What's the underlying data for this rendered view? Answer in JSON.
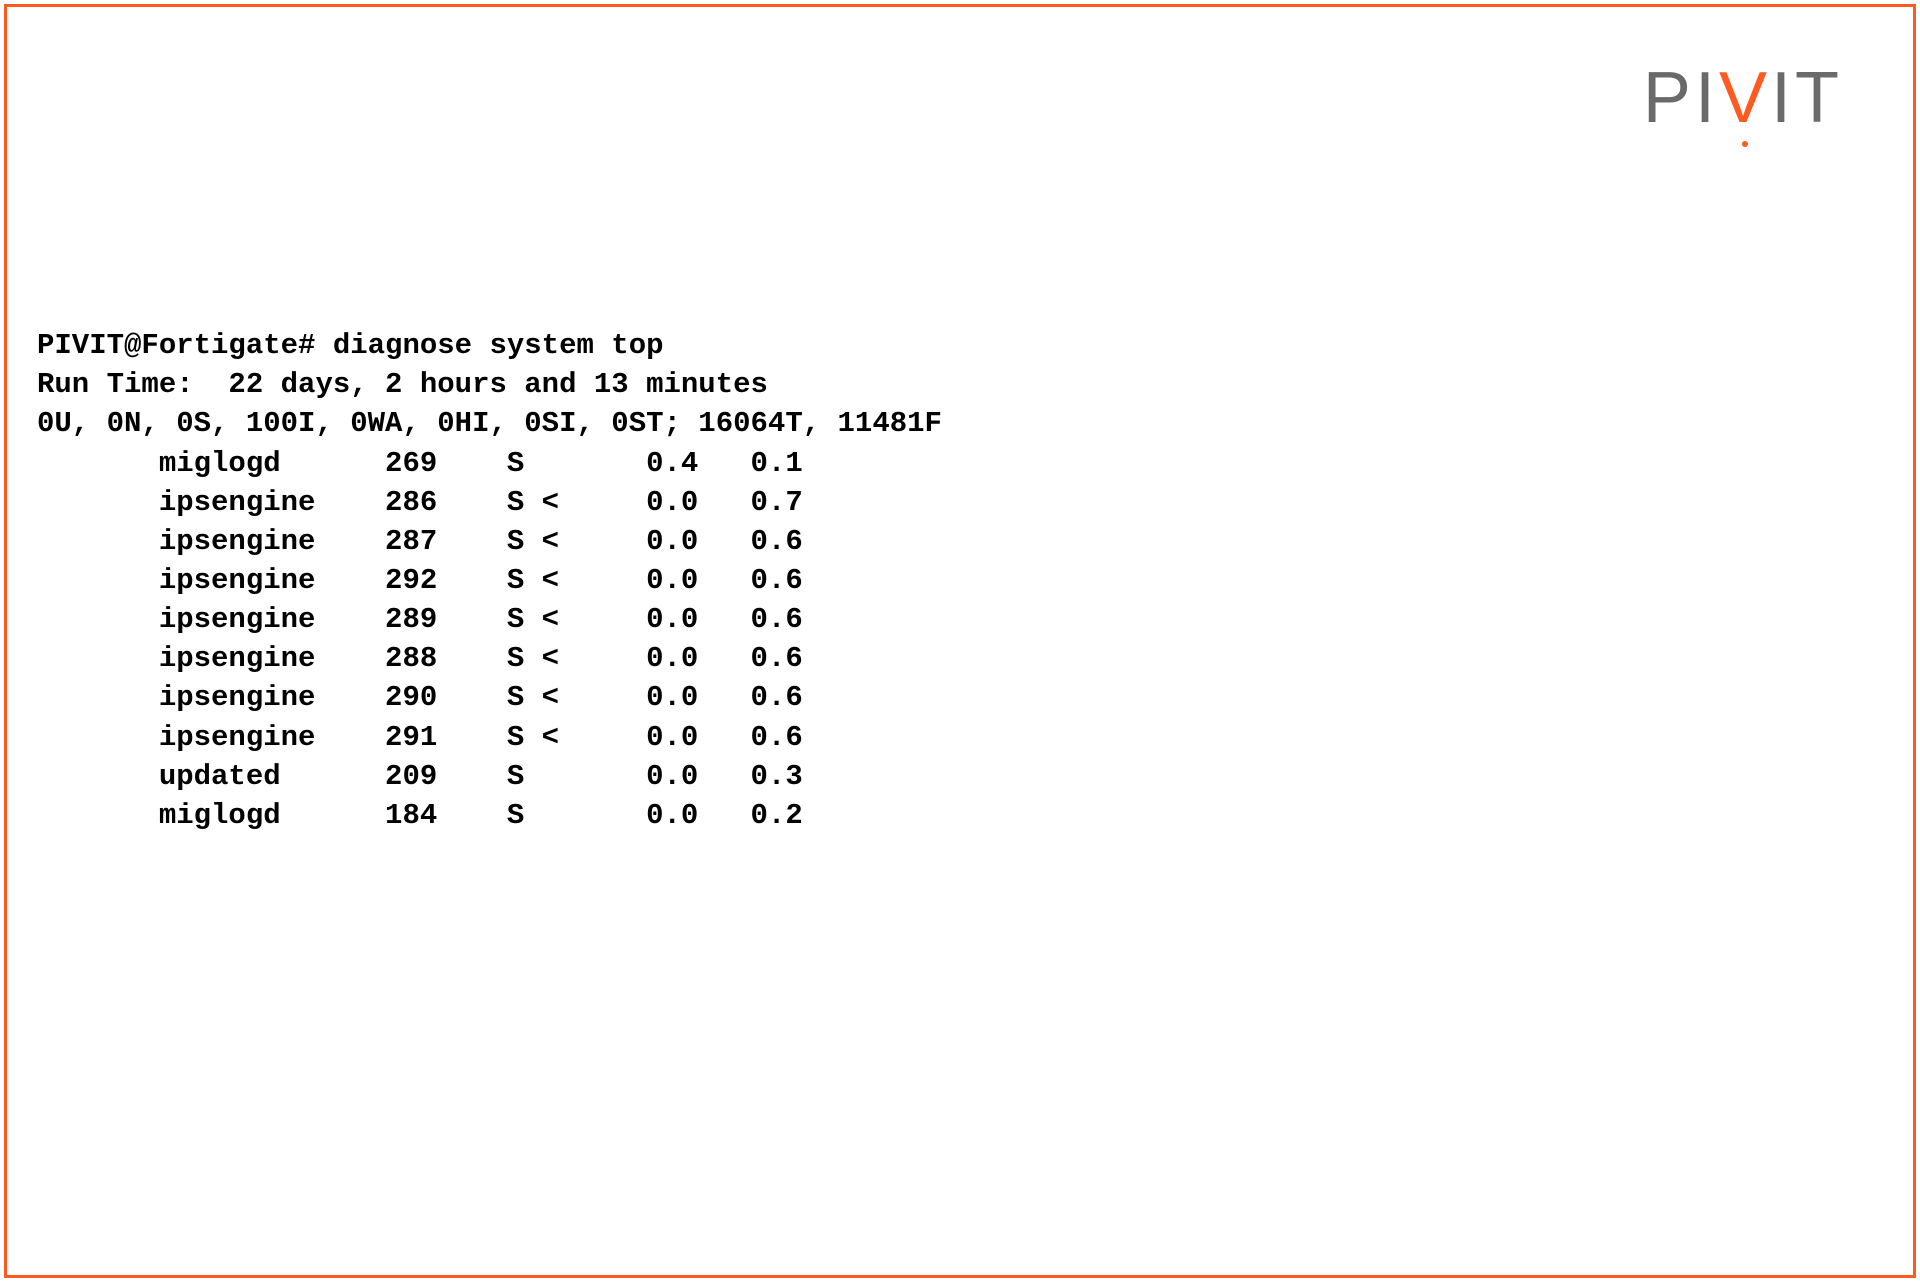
{
  "logo": {
    "p": "P",
    "i1": "I",
    "v": "V",
    "i2": "I",
    "t": "T"
  },
  "terminal": {
    "prompt_line": "PIVIT@Fortigate# diagnose system top",
    "runtime_line": "Run Time:  22 days, 2 hours and 13 minutes",
    "stats_line": "0U, 0N, 0S, 100I, 0WA, 0HI, 0SI, 0ST; 16064T, 11481F",
    "processes": [
      {
        "name": "miglogd",
        "pid": "269",
        "state": "S",
        "cpu": "0.4",
        "mem": "0.1"
      },
      {
        "name": "ipsengine",
        "pid": "286",
        "state": "S <",
        "cpu": "0.0",
        "mem": "0.7"
      },
      {
        "name": "ipsengine",
        "pid": "287",
        "state": "S <",
        "cpu": "0.0",
        "mem": "0.6"
      },
      {
        "name": "ipsengine",
        "pid": "292",
        "state": "S <",
        "cpu": "0.0",
        "mem": "0.6"
      },
      {
        "name": "ipsengine",
        "pid": "289",
        "state": "S <",
        "cpu": "0.0",
        "mem": "0.6"
      },
      {
        "name": "ipsengine",
        "pid": "288",
        "state": "S <",
        "cpu": "0.0",
        "mem": "0.6"
      },
      {
        "name": "ipsengine",
        "pid": "290",
        "state": "S <",
        "cpu": "0.0",
        "mem": "0.6"
      },
      {
        "name": "ipsengine",
        "pid": "291",
        "state": "S <",
        "cpu": "0.0",
        "mem": "0.6"
      },
      {
        "name": "updated",
        "pid": "209",
        "state": "S",
        "cpu": "0.0",
        "mem": "0.3"
      },
      {
        "name": "miglogd",
        "pid": "184",
        "state": "S",
        "cpu": "0.0",
        "mem": "0.2"
      }
    ]
  }
}
